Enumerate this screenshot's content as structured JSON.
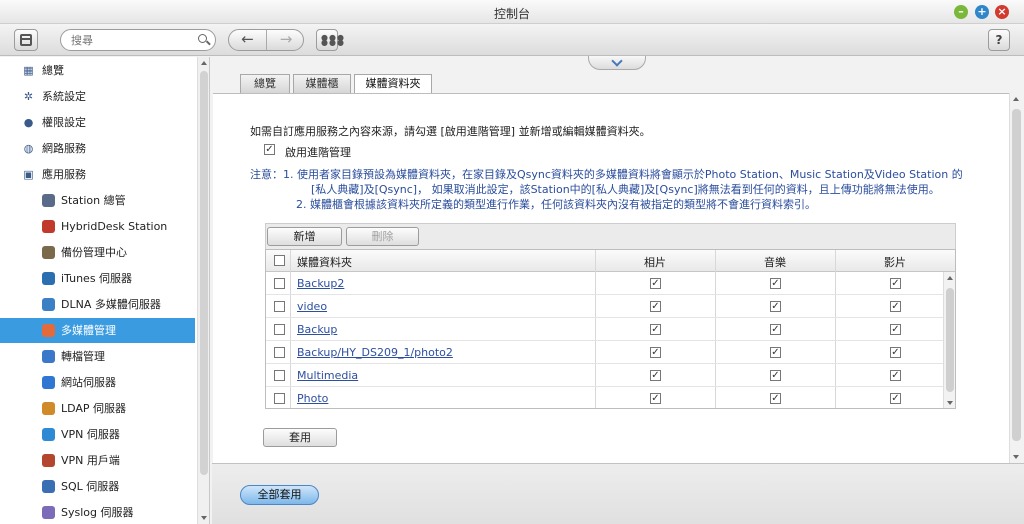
{
  "window": {
    "title": "控制台"
  },
  "toolbar": {
    "search_placeholder": "搜尋",
    "help_label": "?"
  },
  "sidebar": {
    "items": [
      {
        "label": "總覽",
        "icon": "grid-icon",
        "level": "top"
      },
      {
        "label": "系統設定",
        "icon": "gear-icon",
        "level": "top"
      },
      {
        "label": "權限設定",
        "icon": "user-icon",
        "level": "top"
      },
      {
        "label": "網路服務",
        "icon": "globe-icon",
        "level": "top"
      },
      {
        "label": "應用服務",
        "icon": "box-icon",
        "level": "top"
      },
      {
        "label": "Station 總管",
        "icon": "station-icon",
        "level": "sub"
      },
      {
        "label": "HybridDesk Station",
        "icon": "hd-icon",
        "level": "sub"
      },
      {
        "label": "備份管理中心",
        "icon": "backup-icon",
        "level": "sub"
      },
      {
        "label": "iTunes 伺服器",
        "icon": "itunes-icon",
        "level": "sub"
      },
      {
        "label": "DLNA 多媒體伺服器",
        "icon": "dlna-icon",
        "level": "sub"
      },
      {
        "label": "多媒體管理",
        "icon": "multimedia-icon",
        "level": "sub",
        "active": true
      },
      {
        "label": "轉檔管理",
        "icon": "transcode-icon",
        "level": "sub"
      },
      {
        "label": "網站伺服器",
        "icon": "web-icon",
        "level": "sub"
      },
      {
        "label": "LDAP 伺服器",
        "icon": "ldap-icon",
        "level": "sub"
      },
      {
        "label": "VPN 伺服器",
        "icon": "vpn-server-icon",
        "level": "sub"
      },
      {
        "label": "VPN 用戶端",
        "icon": "vpn-client-icon",
        "level": "sub"
      },
      {
        "label": "SQL 伺服器",
        "icon": "sql-icon",
        "level": "sub"
      },
      {
        "label": "Syslog 伺服器",
        "icon": "syslog-icon",
        "level": "sub"
      }
    ]
  },
  "tabs": [
    {
      "label": "總覽"
    },
    {
      "label": "媒體櫃"
    },
    {
      "label": "媒體資料夾",
      "active": true
    }
  ],
  "content": {
    "intro": "如需自訂應用服務之內容來源，請勾選 [啟用進階管理] 並新增或編輯媒體資料夾。",
    "advanced_label": "啟用進階管理",
    "note_line1": "注意：1. 使用者家目錄預設為媒體資料夾，在家目錄及Qsync資料夾的多媒體資料將會顯示於Photo Station、Music Station及Video Station 的",
    "note_line2": "[私人典藏]及[Qsync]， 如果取消此設定，該Station中的[私人典藏]及[Qsync]將無法看到任何的資料，且上傳功能將無法使用。",
    "note_line3": "2. 媒體櫃會根據該資料夾所定義的類型進行作業，任何該資料夾內沒有被指定的類型將不會進行資料索引。",
    "add_label": "新增",
    "delete_label": "刪除",
    "apply_label": "套用"
  },
  "table": {
    "headers": {
      "folder": "媒體資料夾",
      "photo": "相片",
      "music": "音樂",
      "video": "影片"
    },
    "rows": [
      {
        "name": "Backup2"
      },
      {
        "name": "video"
      },
      {
        "name": "Backup"
      },
      {
        "name": "Backup/HY_DS209_1/photo2"
      },
      {
        "name": "Multimedia"
      },
      {
        "name": "Photo"
      }
    ]
  },
  "footer": {
    "apply_all_label": "全部套用"
  },
  "colors": {
    "accent": "#3b9be0",
    "link": "#2d4fa0",
    "note": "#2a4d9c"
  }
}
